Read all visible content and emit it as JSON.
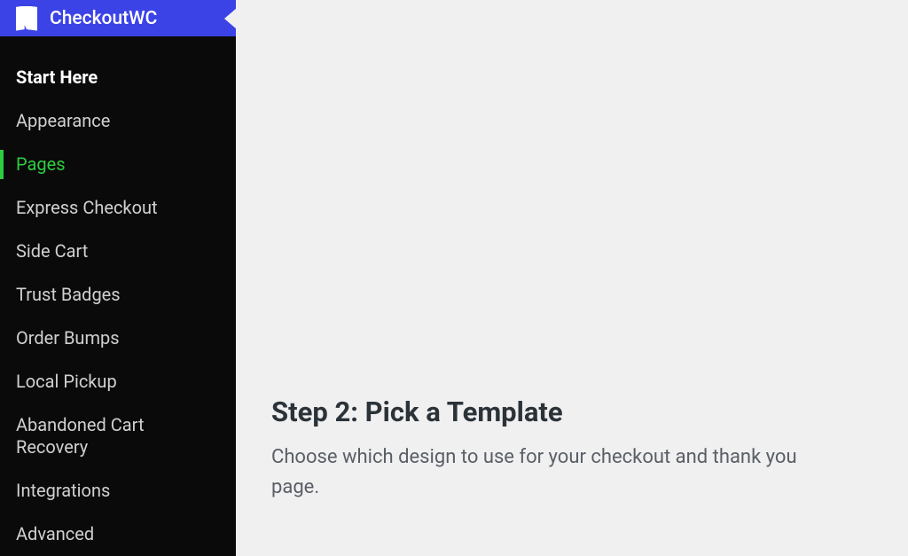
{
  "sidebar": {
    "brand": "CheckoutWC",
    "items": [
      {
        "label": "Start Here",
        "bold": true,
        "active": false
      },
      {
        "label": "Appearance",
        "bold": false,
        "active": false
      },
      {
        "label": "Pages",
        "bold": false,
        "active": true
      },
      {
        "label": "Express Checkout",
        "bold": false,
        "active": false
      },
      {
        "label": "Side Cart",
        "bold": false,
        "active": false
      },
      {
        "label": "Trust Badges",
        "bold": false,
        "active": false
      },
      {
        "label": "Order Bumps",
        "bold": false,
        "active": false
      },
      {
        "label": "Local Pickup",
        "bold": false,
        "active": false
      },
      {
        "label": "Abandoned Cart Recovery",
        "bold": false,
        "active": false
      },
      {
        "label": "Integrations",
        "bold": false,
        "active": false
      },
      {
        "label": "Advanced",
        "bold": false,
        "active": false
      }
    ]
  },
  "main": {
    "step_heading": "Step 2: Pick a Template",
    "step_desc": "Choose which design to use for your checkout and thank you page."
  }
}
